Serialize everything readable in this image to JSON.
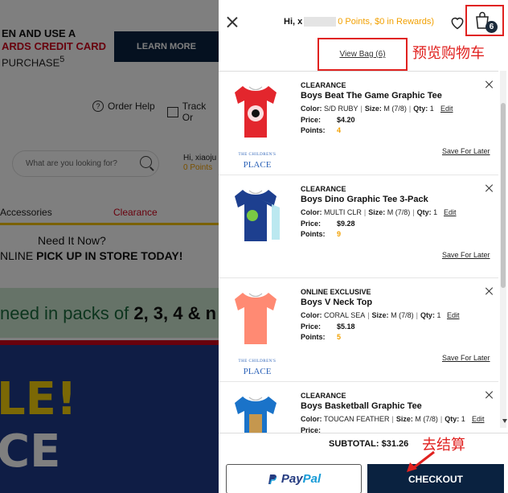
{
  "background": {
    "promo_line1": "EN AND USE A",
    "promo_line2": "ARDS CREDIT CARD",
    "promo_line3": "PURCHASE",
    "promo_sup": "5",
    "learn_more": "LEARN MORE",
    "order_help": "Order Help",
    "track_order": "Track Or",
    "search_placeholder": "What are you looking for?",
    "greet_name": "Hi, xiaoju",
    "greet_points": "0 Points",
    "nav_accessories": "Accessories",
    "nav_clearance": "Clearance",
    "pickup_line1": "Need It Now?",
    "pickup_line2_normal": "NLINE ",
    "pickup_line2_bold": "PICK UP IN STORE TODAY!",
    "pack_text": "need in packs of ",
    "pack_bold": "2, 3, 4 & n",
    "sale_line1": "LE!",
    "sale_line2": "CE"
  },
  "drawer": {
    "greeting_prefix": "Hi, x",
    "points_text": "0 Points, $0 in Rewards)",
    "bag_count": "6",
    "view_bag": "View Bag (6)",
    "annotation_preview": "预览购物车",
    "annotation_checkout": "去结算",
    "subtotal": "SUBTOTAL: $31.26",
    "paypal_1": "Pay",
    "paypal_2": "Pal",
    "checkout": "CHECKOUT",
    "labels": {
      "color": "Color:",
      "size": "Size:",
      "qty": "Qty:",
      "price": "Price:",
      "points": "Points:",
      "edit": "Edit",
      "save_for_later": "Save For Later"
    },
    "brand_small": "THE CHILDREN'S",
    "brand_big": "PLACE",
    "items": [
      {
        "tag": "CLEARANCE",
        "name": "Boys Beat The Game Graphic Tee",
        "color": "S/D RUBY",
        "size": "M (7/8)",
        "qty": "1",
        "price": "$4.20",
        "points": "4",
        "shirt_color": "#e3262d",
        "print": "BEAT THE GAME"
      },
      {
        "tag": "CLEARANCE",
        "name": "Boys Dino Graphic Tee 3-Pack",
        "color": "MULTI CLR",
        "size": "M (7/8)",
        "qty": "1",
        "price": "$9.28",
        "points": "9",
        "shirt_color": "#1d3f8f",
        "print": ""
      },
      {
        "tag": "ONLINE EXCLUSIVE",
        "name": "Boys V Neck Top",
        "color": "CORAL SEA",
        "size": "M (7/8)",
        "qty": "1",
        "price": "$5.18",
        "points": "5",
        "shirt_color": "#ff8a73",
        "print": ""
      },
      {
        "tag": "CLEARANCE",
        "name": "Boys Basketball Graphic Tee",
        "color": "TOUCAN FEATHER",
        "size": "M (7/8)",
        "qty": "1",
        "price": "",
        "points": "",
        "shirt_color": "#1a73c9",
        "print": ""
      }
    ]
  }
}
